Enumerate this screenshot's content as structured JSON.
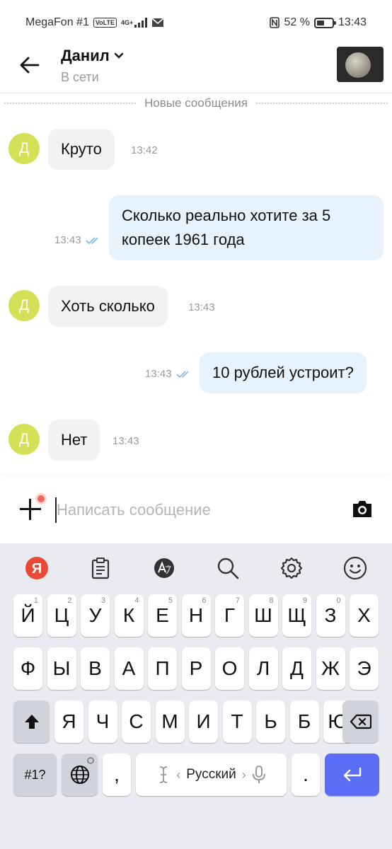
{
  "status_bar": {
    "carrier": "MegaFon #1",
    "volte": "VoLTE",
    "network": "4G+",
    "battery_percent": "52 %",
    "battery_level": 0.52,
    "time": "13:43"
  },
  "header": {
    "contact_name": "Данил",
    "contact_status": "В сети"
  },
  "divider": {
    "label": "Новые сообщения"
  },
  "messages": [
    {
      "direction": "in",
      "avatar_letter": "Д",
      "text": "Круто",
      "time": "13:42"
    },
    {
      "direction": "out",
      "text_line1": "Сколько реально хотите за 5",
      "text_line2": "копеек 1961 года",
      "time": "13:43",
      "read": true
    },
    {
      "direction": "in",
      "avatar_letter": "Д",
      "text": "Хоть сколько",
      "time": "13:43"
    },
    {
      "direction": "out",
      "text": "10 рублей устроит?",
      "time": "13:43",
      "read": true
    },
    {
      "direction": "in",
      "avatar_letter": "Д",
      "text": "Нет",
      "time": "13:43"
    }
  ],
  "composer": {
    "placeholder": "Написать сообщение"
  },
  "keyboard": {
    "row1": [
      {
        "k": "Й",
        "n": "1"
      },
      {
        "k": "Ц",
        "n": "2"
      },
      {
        "k": "У",
        "n": "3"
      },
      {
        "k": "К",
        "n": "4"
      },
      {
        "k": "Е",
        "n": "5"
      },
      {
        "k": "Н",
        "n": "6"
      },
      {
        "k": "Г",
        "n": "7"
      },
      {
        "k": "Ш",
        "n": "8"
      },
      {
        "k": "Щ",
        "n": "9"
      },
      {
        "k": "З",
        "n": "0"
      },
      {
        "k": "Х",
        "n": ""
      }
    ],
    "row2": [
      "Ф",
      "Ы",
      "В",
      "А",
      "П",
      "Р",
      "О",
      "Л",
      "Д",
      "Ж",
      "Э"
    ],
    "row3": [
      "Я",
      "Ч",
      "С",
      "М",
      "И",
      "Т",
      "Ь",
      "Б",
      "Ю"
    ],
    "symbols_label": "#1?",
    "comma": ",",
    "space_label": "Русский",
    "period": "."
  },
  "colors": {
    "incoming_bubble": "#f2f2f2",
    "outgoing_bubble": "#e6f3fd",
    "avatar": "#d4e157",
    "enter_key": "#5a6ef5",
    "yandex_logo": "#e94a35",
    "notification_dot": "#f1675d"
  },
  "icons": {
    "back": "arrow-left-icon",
    "dropdown": "chevron-down-icon",
    "read": "double-check-icon",
    "attach": "plus-icon",
    "camera": "camera-icon",
    "toolbar": [
      "yandex-icon",
      "clipboard-icon",
      "translate-icon",
      "search-icon",
      "settings-icon",
      "emoji-icon"
    ],
    "shift": "shift-icon",
    "backspace": "backspace-icon",
    "globe": "globe-icon",
    "cursor": "text-cursor-icon",
    "mic": "microphone-icon",
    "enter": "enter-icon"
  }
}
